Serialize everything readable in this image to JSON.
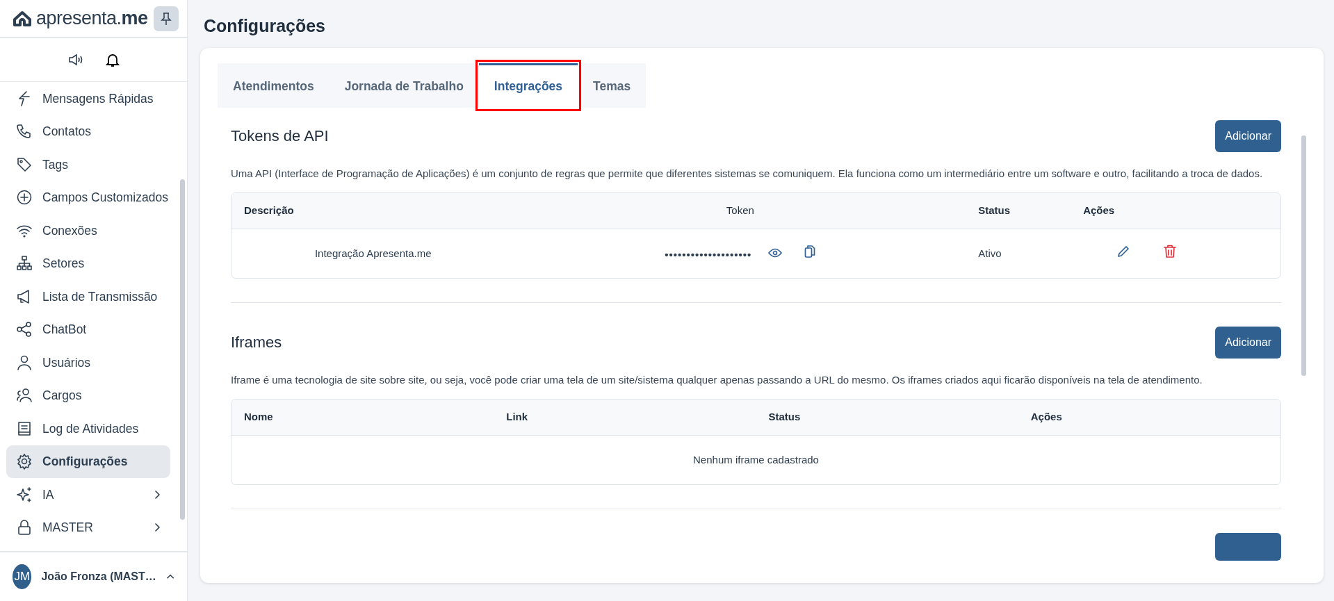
{
  "sidebar": {
    "logo": "apresenta.**me**",
    "items": [
      {
        "label": "Mensagens Rápidas",
        "selected": false,
        "submenu": false
      },
      {
        "label": "Contatos",
        "selected": false,
        "submenu": false
      },
      {
        "label": "Tags",
        "selected": false,
        "submenu": false
      },
      {
        "label": "Campos Customizados",
        "selected": false,
        "submenu": false
      },
      {
        "label": "Conexões",
        "selected": false,
        "submenu": false
      },
      {
        "label": "Setores",
        "selected": false,
        "submenu": false
      },
      {
        "label": "Lista de Transmissão",
        "selected": false,
        "submenu": false
      },
      {
        "label": "ChatBot",
        "selected": false,
        "submenu": false
      },
      {
        "label": "Usuários",
        "selected": false,
        "submenu": false
      },
      {
        "label": "Cargos",
        "selected": false,
        "submenu": false
      },
      {
        "label": "Log de Atividades",
        "selected": false,
        "submenu": false
      },
      {
        "label": "Configurações",
        "selected": true,
        "submenu": false
      },
      {
        "label": "IA",
        "selected": false,
        "submenu": true
      },
      {
        "label": "MASTER",
        "selected": false,
        "submenu": true
      }
    ],
    "user": {
      "initials": "JM",
      "name": "João Fronza (MAST…"
    }
  },
  "page": {
    "title": "Configurações",
    "tabs": [
      {
        "label": "Atendimentos",
        "selected": false
      },
      {
        "label": "Jornada de Trabalho",
        "selected": false
      },
      {
        "label": "Integrações",
        "selected": true
      },
      {
        "label": "Temas",
        "selected": false
      }
    ],
    "sections": [
      {
        "kind": "tokens",
        "title": "Tokens de API",
        "button": "Adicionar",
        "description": "Uma API (Interface de Programação de Aplicações) é um conjunto de regras que permite que diferentes sistemas se comuniquem. Ela funciona como um intermediário entre um software e outro, facilitando a troca de dados.",
        "columns": [
          "Descrição",
          "Token",
          "Status",
          "Ações"
        ],
        "rows": [
          {
            "description": "Integração Apresenta.me",
            "token": "••••••••••••••••••••",
            "status": "Ativo"
          }
        ]
      },
      {
        "kind": "iframes",
        "title": "Iframes",
        "button": "Adicionar",
        "description": "Iframe é uma tecnologia de site sobre site, ou seja, você pode criar uma tela de um site/sistema qualquer apenas passando a URL do mesmo. Os iframes criados aqui ficarão disponíveis na tela de atendimento.",
        "columns": [
          "Nome",
          "Link",
          "Status",
          "Ações"
        ],
        "empty": "Nenhum iframe cadastrado"
      }
    ]
  }
}
